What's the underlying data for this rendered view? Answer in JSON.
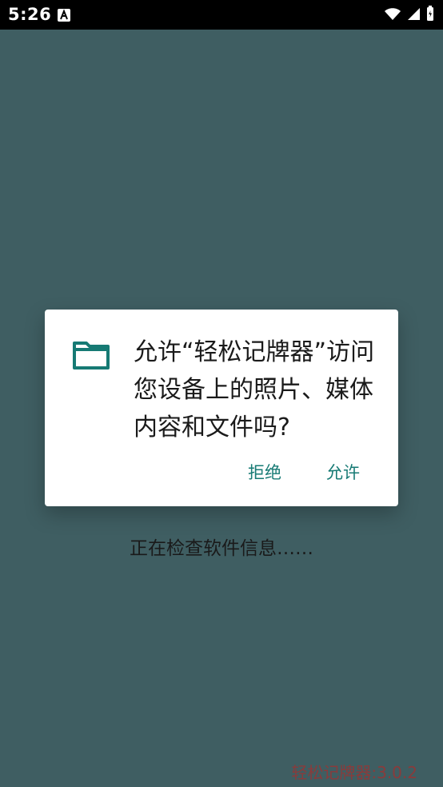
{
  "status_bar": {
    "time": "5:26",
    "icons": [
      "a-icon",
      "wifi-icon",
      "signal-icon",
      "battery-icon"
    ]
  },
  "dialog": {
    "message": "允许“轻松记牌器”访问您设备上的照片、媒体内容和文件吗?",
    "deny_label": "拒绝",
    "allow_label": "允许",
    "icon": "folder-icon",
    "accent_color": "#167a74"
  },
  "background": {
    "loading_text": "正在检查软件信息……",
    "version_text": "轻松记牌器:3.0.2"
  }
}
